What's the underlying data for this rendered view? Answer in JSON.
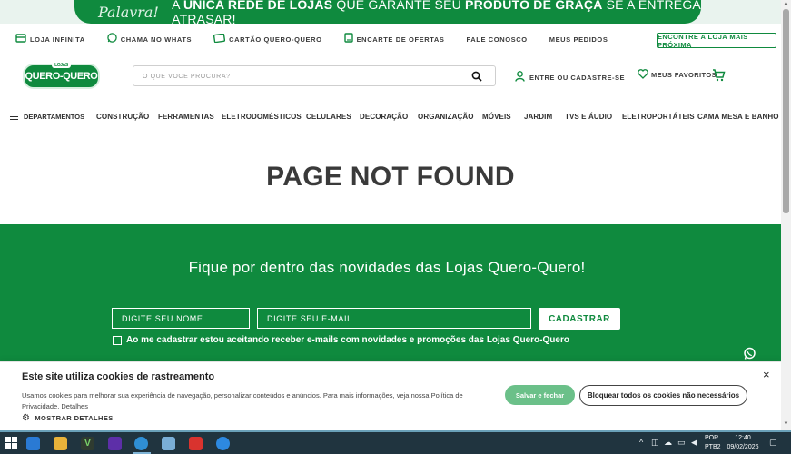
{
  "promo": {
    "script": "Palavra!",
    "pre": "A ",
    "bold1": "ÚNICA REDE DE LOJAS",
    "mid": " QUE GARANTE SEU ",
    "bold2": "PRODUTO DE GRAÇA",
    "post": " SE A ENTREGA ATRASAR!"
  },
  "subnav": {
    "items": [
      "LOJA INFINITA",
      "CHAMA NO WHATS",
      "CARTÃO QUERO-QUERO",
      "ENCARTE DE OFERTAS",
      "FALE CONOSCO",
      "MEUS PEDIDOS"
    ],
    "store_button": "ENCONTRE A LOJA MAIS PRÓXIMA"
  },
  "header": {
    "logo_small": "LOJAS",
    "logo_text": "QUERO-QUERO",
    "search_placeholder": "O QUE VOCÊ PROCURA?",
    "account": "ENTRE OU CADASTRE-SE",
    "favorites": "MEUS FAVORITOS"
  },
  "categories": {
    "menu_label": "DEPARTAMENTOS",
    "items": [
      "CONSTRUÇÃO",
      "FERRAMENTAS",
      "ELETRODOMÉSTICOS",
      "CELULARES",
      "DECORAÇÃO",
      "ORGANIZAÇÃO",
      "MÓVEIS",
      "JARDIM",
      "TVS E ÁUDIO",
      "ELETROPORTÁTEIS",
      "CAMA MESA E BANHO"
    ]
  },
  "main": {
    "title": "PAGE NOT FOUND"
  },
  "newsletter": {
    "title": "Fique por dentro das novidades das Lojas Quero-Quero!",
    "name_placeholder": "DIGITE SEU NOME",
    "email_placeholder": "DIGITE SEU E-MAIL",
    "button": "CADASTRAR",
    "consent": "Ao me cadastrar estou aceitando receber e-mails com novidades e promoções das Lojas Quero-Quero"
  },
  "cookie": {
    "title": "Este site utiliza cookies de rastreamento",
    "text": "Usamos cookies para melhorar sua experiência de navegação, personalizar conteúdos e anúncios. Para mais informações, veja nossa Política de Privacidade.",
    "details_link": "Detalhes",
    "show_details": "MOSTRAR DETALHES",
    "accept": "Salvar e fechar",
    "block": "Bloquear todos os cookies não necessários",
    "close": "×"
  },
  "taskbar": {
    "lang1": "POR",
    "lang2": "PTB2",
    "time": "12:40",
    "date": "09/02/2026"
  },
  "colors": {
    "brand_green": "#0f8a3e",
    "accept_green": "#6bc089",
    "taskbar": "#20343f"
  }
}
